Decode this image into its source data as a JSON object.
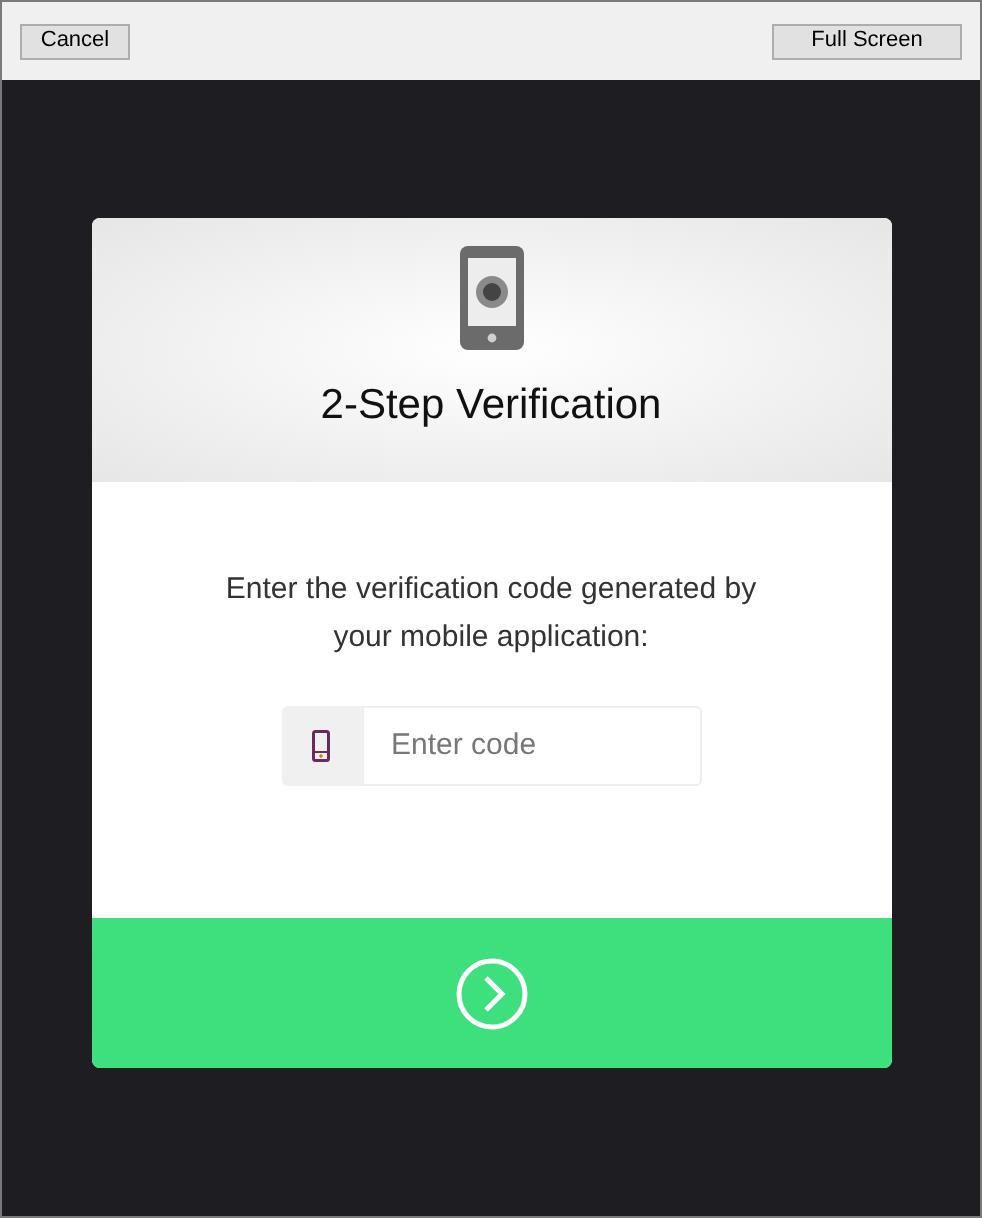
{
  "toolbar": {
    "buttons": [
      {
        "label": "Cancel"
      },
      {
        "label": "Full Screen"
      }
    ]
  },
  "dialog": {
    "title": "2-Step Verification",
    "instructions": "Enter the verification code generated by your mobile application:",
    "code_field": {
      "placeholder": "Enter code"
    }
  }
}
